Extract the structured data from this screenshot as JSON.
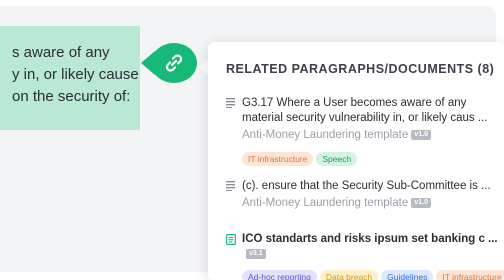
{
  "document": {
    "lines": [
      "s aware of any",
      "y in, or likely cause",
      "on the security of:"
    ]
  },
  "panel": {
    "title": "RELATED PARAGRAPHS/DOCUMENTS (8)",
    "items": [
      {
        "icon": "paragraph-lines-icon",
        "title_line1": "G3.17 Where a User becomes aware of any",
        "title_line2": "material security vulnerability in, or likely caus ...",
        "source": "Anti-Money Laundering template",
        "version": "v1.0",
        "tags": [
          {
            "label": "IT infrastructure",
            "bg": "#fde4d3",
            "fg": "#e0783a"
          },
          {
            "label": "Speech",
            "bg": "#d4f3e4",
            "fg": "#1f9e62"
          }
        ]
      },
      {
        "icon": "paragraph-lines-icon",
        "title_line1": "(c).  ensure that the Security Sub-Committee is ...",
        "source": "Anti-Money Laundering template",
        "version": "v1.0",
        "tags": []
      },
      {
        "icon": "document-icon",
        "title_line1": "ICO standarts and risks ipsum set banking c ...",
        "version": "v3.1",
        "tags": [
          {
            "label": "Ad-hoc reporting",
            "bg": "#e3e2fb",
            "fg": "#5a55d4"
          },
          {
            "label": "Data breach",
            "bg": "#fdf0c8",
            "fg": "#d19a10"
          },
          {
            "label": "Guidelines",
            "bg": "#dbe8fd",
            "fg": "#2f6fde"
          },
          {
            "label": "IT infrastructure",
            "bg": "#fde4d3",
            "fg": "#e0783a"
          }
        ]
      }
    ]
  },
  "colors": {
    "accent": "#17b978",
    "highlight": "#b9e9d4"
  }
}
